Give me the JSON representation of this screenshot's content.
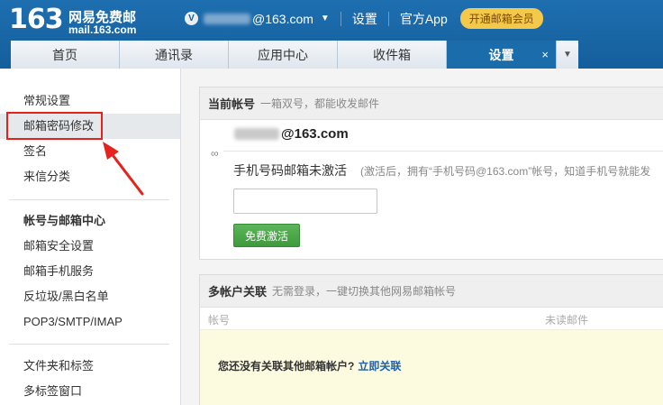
{
  "header": {
    "logo_number": "163",
    "logo_name": "网易免费邮",
    "logo_domain": "mail.163.com",
    "account_icon": "V",
    "account_suffix": "@163.com",
    "settings_link": "设置",
    "app_link": "官方App",
    "vip_button": "开通邮箱会员"
  },
  "tabs": [
    {
      "label": "首页"
    },
    {
      "label": "通讯录"
    },
    {
      "label": "应用中心"
    },
    {
      "label": "收件箱"
    },
    {
      "label": "设置",
      "close": "×"
    }
  ],
  "sidebar": {
    "general": [
      {
        "label": "常规设置"
      },
      {
        "label": "邮箱密码修改"
      },
      {
        "label": "签名"
      },
      {
        "label": "来信分类"
      }
    ],
    "account_section": {
      "title": "帐号与邮箱中心",
      "items": [
        {
          "label": "邮箱安全设置"
        },
        {
          "label": "邮箱手机服务"
        },
        {
          "label": "反垃圾/黑白名单"
        },
        {
          "label": "POP3/SMTP/IMAP"
        }
      ]
    },
    "folder_section": [
      {
        "label": "文件夹和标签"
      },
      {
        "label": "多标签窗口"
      }
    ]
  },
  "current_account": {
    "title": "当前帐号",
    "desc": "一箱双号，都能收发邮件",
    "email_suffix": "@163.com",
    "phone_label": "手机号码邮箱未激活",
    "phone_desc": "(激活后，拥有“手机号码@163.com”帐号，知道手机号就能发",
    "activate_button": "免费激活"
  },
  "multi_account": {
    "title": "多帐户关联",
    "desc": "无需登录，一键切换其他网易邮箱帐号",
    "col_account": "帐号",
    "col_unread": "未读邮件",
    "empty_text": "您还没有关联其他邮箱帐户?",
    "empty_link": "立即关联"
  },
  "colors": {
    "header_blue": "#155e9c",
    "active_tab": "#1b6cab",
    "highlight_red": "#e3231c",
    "activate_green": "#4aa747",
    "empty_yellow": "#fcfbe0"
  }
}
